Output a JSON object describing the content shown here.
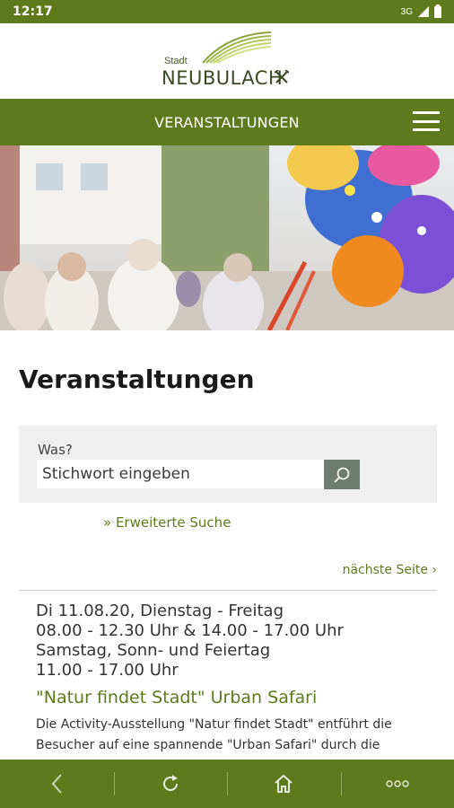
{
  "status": {
    "time": "12:17",
    "network": "3G"
  },
  "logo": {
    "small": "Stadt",
    "name": "NEUBULACH"
  },
  "nav": {
    "title": "VERANSTALTUNGEN"
  },
  "page": {
    "heading": "Veranstaltungen"
  },
  "search": {
    "label": "Was?",
    "placeholder": "Stichwort eingeben",
    "advanced": "» Erweiterte Suche"
  },
  "pagination": {
    "next": "nächste Seite ›"
  },
  "event": {
    "date_line1": "Di 11.08.20, Dienstag - Freitag",
    "date_line2": "08.00 - 12.30 Uhr & 14.00 - 17.00 Uhr",
    "date_line3": "Samstag, Sonn- und Feiertag",
    "date_line4": "11.00 - 17.00 Uhr",
    "title": "\"Natur findet Stadt\" Urban Safari",
    "description": "Die Activity-Ausstellung \"Natur findet Stadt\" entführt die Besucher auf eine spannende \"Urban Safari\" durch die"
  },
  "bottom_nav": {
    "icons": [
      "back-icon",
      "reload-icon",
      "home-icon",
      "more-icon"
    ]
  },
  "colors": {
    "primary": "#5e7a1c",
    "search_button": "#6f7c72"
  }
}
